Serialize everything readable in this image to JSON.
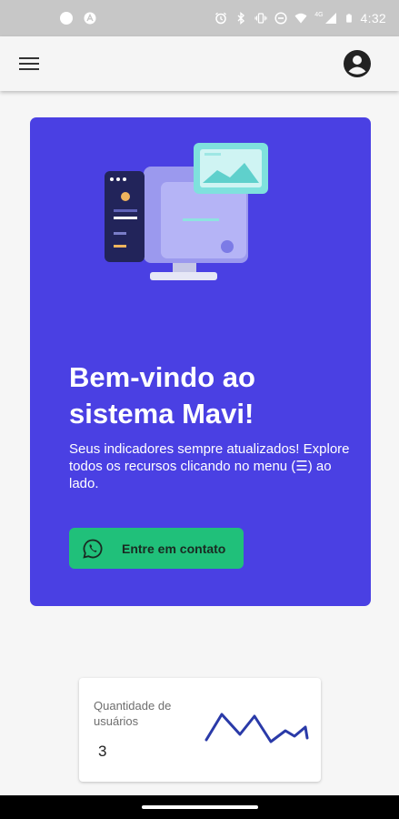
{
  "status_bar": {
    "time": "4:32",
    "network_label": "4G",
    "icons": [
      "notification-dot-icon",
      "app-notification-icon",
      "alarm-icon",
      "bluetooth-icon",
      "vibrate-icon",
      "do-not-disturb-icon",
      "wifi-icon",
      "signal-icon",
      "battery-icon"
    ]
  },
  "app_bar": {
    "icons": [
      "menu-icon",
      "account-circle-icon"
    ]
  },
  "hero": {
    "title": "Bem-vindo ao sistema Mavi!",
    "description": "Seus indicadores sempre atualizados! Explore todos os recursos clicando no menu (☰) ao lado.",
    "contact_button_label": "Entre em contato",
    "contact_icon": "whatsapp-icon",
    "background_color": "#4a40e3",
    "button_color": "#20c07a"
  },
  "metric": {
    "label": "Quantidade de usuários",
    "value": "3",
    "sparkline_color": "#2a3aa8"
  }
}
